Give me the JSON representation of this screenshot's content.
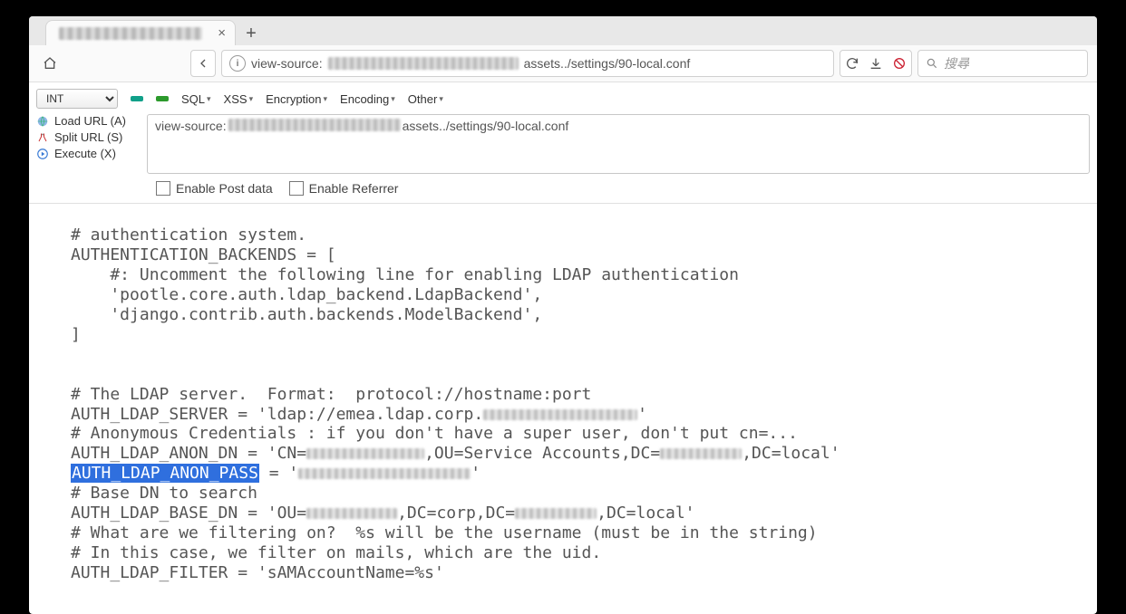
{
  "tabstrip": {
    "close_glyph": "×",
    "newtab_glyph": "+"
  },
  "addr": {
    "prefix": "view-source:",
    "suffix": "assets../settings/90-local.conf",
    "search_placeholder": "搜尋"
  },
  "hackbar": {
    "select_value": "INT",
    "menu": [
      "SQL",
      "XSS",
      "Encryption",
      "Encoding",
      "Other"
    ],
    "load_url": "Load URL (A)",
    "split_url": "Split URL (S)",
    "execute": "Execute (X)",
    "url_prefix": "view-source:",
    "url_suffix": "assets../settings/90-local.conf",
    "enable_post": "Enable Post data",
    "enable_ref": "Enable Referrer"
  },
  "source": {
    "l1": "# authentication system.",
    "l2": "AUTHENTICATION_BACKENDS = [",
    "l3": "    #: Uncomment the following line for enabling LDAP authentication",
    "l4": "    'pootle.core.auth.ldap_backend.LdapBackend',",
    "l5": "    'django.contrib.auth.backends.ModelBackend',",
    "l6": "]",
    "blank": " ",
    "l7": "# The LDAP server.  Format:  protocol://hostname:port",
    "l8a": "AUTH_LDAP_SERVER = 'ldap://emea.ldap.corp.",
    "l8b": "'",
    "l9": "# Anonymous Credentials : if you don't have a super user, don't put cn=...",
    "l10a": "AUTH_LDAP_ANON_DN = 'CN=",
    "l10b": ",OU=Service Accounts,DC=",
    "l10c": ",DC=local'",
    "l11a": "AUTH_LDAP_ANON_PASS",
    "l11b": " = '",
    "l11c": "'",
    "l12": "# Base DN to search",
    "l13a": "AUTH_LDAP_BASE_DN = 'OU=",
    "l13b": ",DC=corp,DC=",
    "l13c": ",DC=local'",
    "l14": "# What are we filtering on?  %s will be the username (must be in the string)",
    "l15": "# In this case, we filter on mails, which are the uid.",
    "l16": "AUTH_LDAP_FILTER = 'sAMAccountName=%s'"
  }
}
